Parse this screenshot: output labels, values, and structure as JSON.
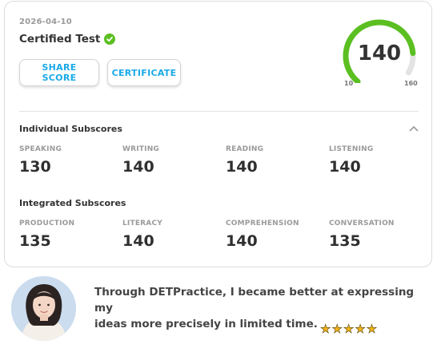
{
  "card": {
    "date": "2026-04-10",
    "title": "Certified Test",
    "share_label": "SHARE SCORE",
    "certificate_label": "CERTIFICATE",
    "gauge": {
      "value": "140",
      "min": "10",
      "max": "160",
      "score": 140,
      "range": [
        10,
        160
      ],
      "color": "#5bbf21"
    }
  },
  "individual": {
    "title": "Individual Subscores",
    "items": [
      {
        "label": "SPEAKING",
        "value": "130"
      },
      {
        "label": "WRITING",
        "value": "140"
      },
      {
        "label": "READING",
        "value": "140"
      },
      {
        "label": "LISTENING",
        "value": "140"
      }
    ]
  },
  "integrated": {
    "title": "Integrated Subscores",
    "items": [
      {
        "label": "PRODUCTION",
        "value": "135"
      },
      {
        "label": "LITERACY",
        "value": "140"
      },
      {
        "label": "COMPREHENSION",
        "value": "140"
      },
      {
        "label": "CONVERSATION",
        "value": "135"
      }
    ]
  },
  "testimonial": {
    "quote_line1": "Through DETPractice, I became better at expressing my",
    "quote_line2": "ideas more precisely in limited time.",
    "rating": 5,
    "stars": "★★★★★"
  },
  "colors": {
    "accent": "#1aa9e8",
    "success": "#5bbf21",
    "star": "#f2b21a"
  }
}
